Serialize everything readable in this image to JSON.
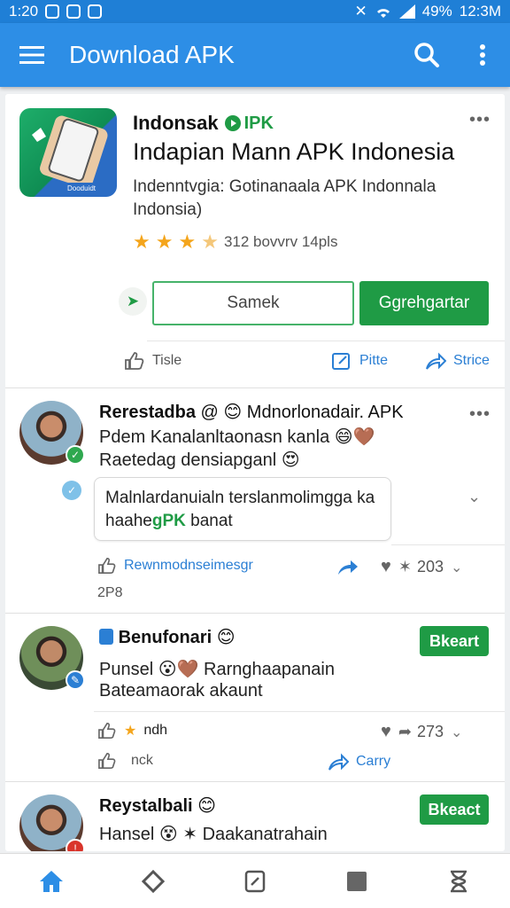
{
  "status_bar": {
    "left_time": "1:20",
    "battery": "49%",
    "time": "12:3M"
  },
  "app_bar": {
    "title": "Download APK"
  },
  "app_card": {
    "name": "Indonsak",
    "badge": "IPK",
    "title": "Indapian Mann APK Indonesia",
    "description": "Indenntvgia:  Gotinanaala   APK Indonnala Indonsia)",
    "rating_text": "312 bovvrv  14pls",
    "stars_filled": 3.5,
    "buttons": {
      "secondary": "Samek",
      "primary": "Ggrehgartar"
    },
    "actions": {
      "like": "Tisle",
      "print": "Pitte",
      "share": "Strice"
    }
  },
  "posts": [
    {
      "user": "Rerestadba",
      "line1_suffix": "Mdnorlonadair. APK",
      "line2": "Pdem Kanalanltaonasn kanla",
      "line3": "Raetedag densiapganl",
      "bubble_text": "Malnlardanuialn terslanmolimgga ka",
      "bubble_text2_pre": "haahe",
      "bubble_text2_green": "gPK",
      "bubble_text2_post": " banat",
      "action_link": "Rewnmodnseimesgr",
      "sub_count": "2P8",
      "count": "203"
    },
    {
      "user": "Benufonari",
      "button": "Bkeart",
      "line2": "Punsel",
      "line2_rest": "Rarnghaapanain",
      "line3": "Bateamaorak akaunt",
      "react_label": "ndh",
      "count": "273",
      "secondary_label": "nck",
      "copy_label": "Carry"
    },
    {
      "user": "Reystalbali",
      "button": "Bkeact",
      "line2": "Hansel",
      "line2_rest": "Daakanatrahain"
    }
  ],
  "colors": {
    "primary": "#2d8ee6",
    "accent_green": "#1f9b45",
    "link_blue": "#2b7fd4"
  }
}
